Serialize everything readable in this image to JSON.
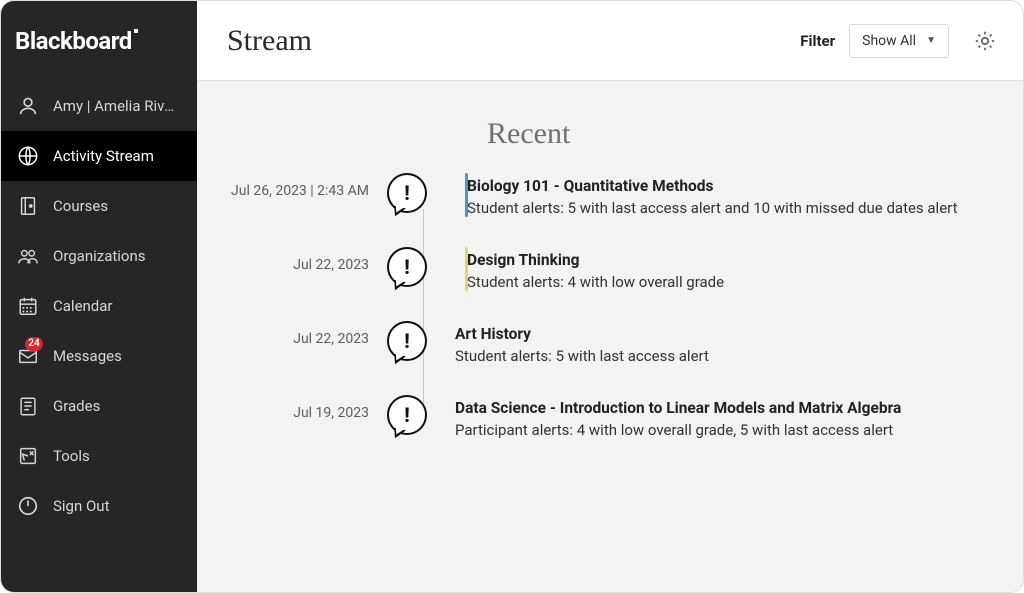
{
  "brand": "Blackboard",
  "user": {
    "display": "Amy | Amelia Rivera"
  },
  "sidebar": {
    "items": [
      {
        "key": "user",
        "label": "Amy | Amelia Rivera",
        "icon": "person-icon"
      },
      {
        "key": "activity",
        "label": "Activity Stream",
        "icon": "globe-icon",
        "active": true
      },
      {
        "key": "courses",
        "label": "Courses",
        "icon": "book-icon"
      },
      {
        "key": "orgs",
        "label": "Organizations",
        "icon": "people-icon"
      },
      {
        "key": "calendar",
        "label": "Calendar",
        "icon": "calendar-icon"
      },
      {
        "key": "messages",
        "label": "Messages",
        "icon": "envelope-icon",
        "badge": "24"
      },
      {
        "key": "grades",
        "label": "Grades",
        "icon": "grades-icon"
      },
      {
        "key": "tools",
        "label": "Tools",
        "icon": "tools-icon"
      },
      {
        "key": "signout",
        "label": "Sign Out",
        "icon": "signout-icon"
      }
    ]
  },
  "header": {
    "title": "Stream",
    "filter_label": "Filter",
    "filter_value": "Show All"
  },
  "stream": {
    "section_title": "Recent",
    "items": [
      {
        "date": "Jul 26, 2023 | 2:43 AM",
        "title": "Biology 101 - Quantitative Methods",
        "desc": "Student alerts: 5 with last access alert and 10 with missed due dates alert",
        "accent": "blue"
      },
      {
        "date": "Jul 22, 2023",
        "title": "Design Thinking",
        "desc": "Student alerts: 4 with low overall grade",
        "accent": "yellow"
      },
      {
        "date": "Jul 22, 2023",
        "title": "Art History",
        "desc": "Student alerts: 5 with last access alert",
        "accent": "none"
      },
      {
        "date": "Jul 19, 2023",
        "title": "Data Science - Introduction to Linear Models and Matrix Algebra",
        "desc": "Participant alerts: 4 with low overall grade, 5 with last access alert",
        "accent": "none"
      }
    ]
  }
}
